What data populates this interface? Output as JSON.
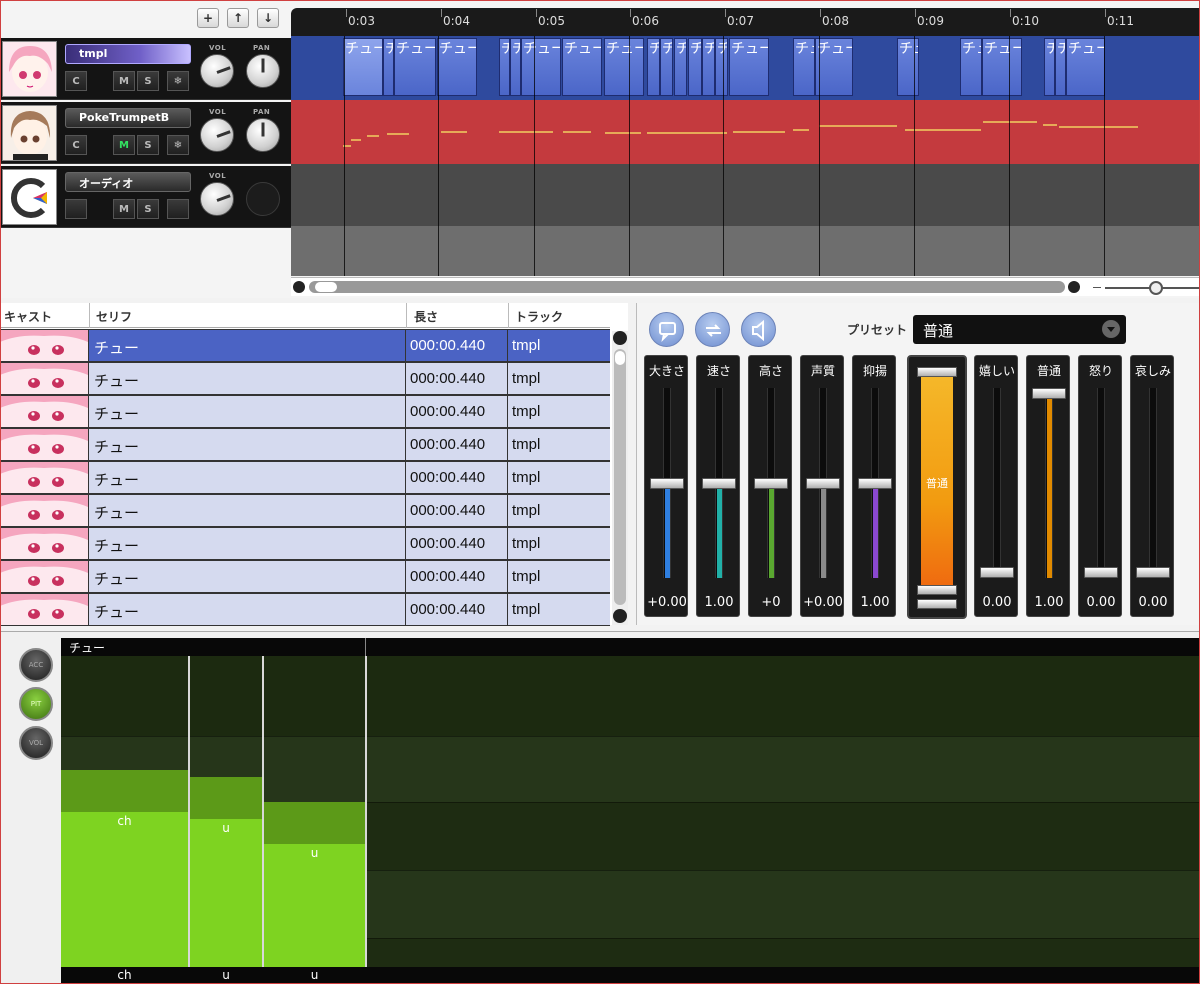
{
  "toolbar": {
    "add_icon": "+",
    "up_icon": "↑",
    "down_icon": "↓"
  },
  "ruler": {
    "ticks": [
      "0:03",
      "0:04",
      "0:05",
      "0:06",
      "0:07",
      "0:08",
      "0:09",
      "0:10",
      "0:11"
    ]
  },
  "tracks": [
    {
      "name": "tmpl",
      "buttons": [
        "C",
        "M",
        "S",
        "❄"
      ],
      "vol_label": "VOL",
      "pan_label": "PAN"
    },
    {
      "name": "PokeTrumpetB",
      "buttons": [
        "C",
        "M",
        "S",
        "❄"
      ],
      "vol_label": "VOL",
      "pan_label": "PAN"
    },
    {
      "name": "オーディオ",
      "buttons": [
        "M",
        "S"
      ],
      "vol_label": "VOL"
    }
  ],
  "lane_segments": [
    "チュー",
    "チュー",
    "チュー",
    "チュー",
    "チュー",
    "チュー",
    "チュー",
    "チュー",
    "チュー",
    "チュー",
    "チュー",
    "チュー",
    "チュー",
    "チュー",
    "チュー",
    "チュー",
    "チュー",
    "チュー",
    "チュー",
    "チュー",
    "チュー",
    "チュー",
    "チュー",
    "チュー",
    "チュー",
    "チュー"
  ],
  "table": {
    "headers": {
      "cast": "キャスト",
      "line": "セリフ",
      "length": "長さ",
      "track": "トラック"
    },
    "rows": [
      {
        "line": "チュー",
        "length": "000:00.440",
        "track": "tmpl"
      },
      {
        "line": "チュー",
        "length": "000:00.440",
        "track": "tmpl"
      },
      {
        "line": "チュー",
        "length": "000:00.440",
        "track": "tmpl"
      },
      {
        "line": "チュー",
        "length": "000:00.440",
        "track": "tmpl"
      },
      {
        "line": "チュー",
        "length": "000:00.440",
        "track": "tmpl"
      },
      {
        "line": "チュー",
        "length": "000:00.440",
        "track": "tmpl"
      },
      {
        "line": "チュー",
        "length": "000:00.440",
        "track": "tmpl"
      },
      {
        "line": "チュー",
        "length": "000:00.440",
        "track": "tmpl"
      },
      {
        "line": "チュー",
        "length": "000:00.440",
        "track": "tmpl"
      }
    ]
  },
  "params": {
    "preset_label": "プリセット",
    "preset_value": "普通",
    "sliders": [
      {
        "name": "大きさ",
        "value": "+0.00",
        "color": "#2f7fe0",
        "level": 0.5
      },
      {
        "name": "速さ",
        "value": "1.00",
        "color": "#21b0a8",
        "level": 0.5
      },
      {
        "name": "高さ",
        "value": "+0",
        "color": "#5aa830",
        "level": 0.5
      },
      {
        "name": "声質",
        "value": "+0.00",
        "color": "#8a8a8a",
        "level": 0.5
      },
      {
        "name": "抑揚",
        "value": "1.00",
        "color": "#8a48d0",
        "level": 0.5
      }
    ],
    "emotion_main": "普通",
    "emotions": [
      {
        "name": "嬉しい",
        "value": "0.00",
        "color": "#e08a00",
        "level": 0
      },
      {
        "name": "普通",
        "value": "1.00",
        "color": "#e08a00",
        "level": 1
      },
      {
        "name": "怒り",
        "value": "0.00",
        "color": "#e08a00",
        "level": 0
      },
      {
        "name": "哀しみ",
        "value": "0.00",
        "color": "#e08a00",
        "level": 0
      }
    ]
  },
  "editor": {
    "modes": [
      "ACC",
      "PIT",
      "VOL"
    ],
    "active_mode": "PIT",
    "phrase": "チュー",
    "phonemes": [
      "ch",
      "u",
      "u"
    ]
  }
}
